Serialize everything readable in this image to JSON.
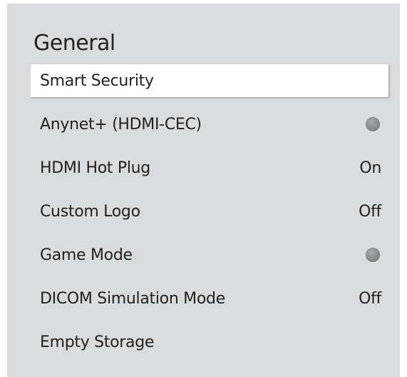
{
  "panel": {
    "title": "General"
  },
  "menu": {
    "items": [
      {
        "label": "Smart Security",
        "value": "",
        "control": "none",
        "selected": true
      },
      {
        "label": "Anynet+ (HDMI-CEC)",
        "value": "",
        "control": "toggle",
        "toggle_state": "off"
      },
      {
        "label": "HDMI Hot Plug",
        "value": "On",
        "control": "value"
      },
      {
        "label": "Custom Logo",
        "value": "Off",
        "control": "value"
      },
      {
        "label": "Game Mode",
        "value": "",
        "control": "toggle",
        "toggle_state": "off"
      },
      {
        "label": "DICOM Simulation Mode",
        "value": "Off",
        "control": "value"
      },
      {
        "label": "Empty Storage",
        "value": "",
        "control": "none"
      }
    ]
  },
  "colors": {
    "panel_background": "#dadbdc",
    "selected_background": "#ffffff",
    "text": "#222222",
    "toggle_off": "#8a8b8c"
  }
}
